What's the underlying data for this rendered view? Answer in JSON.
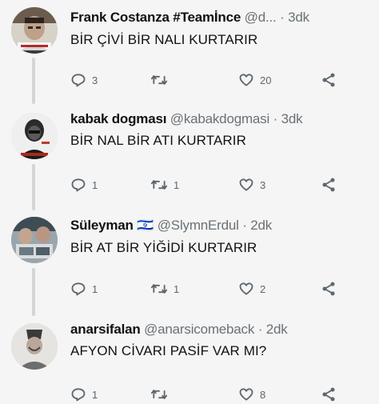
{
  "tweets": [
    {
      "name": "Frank Costanza #Teamİnce",
      "handle": "@d...",
      "time": "3dk",
      "text": "BİR ÇİVİ BİR NALI KURTARIR",
      "replies": "3",
      "retweets": "",
      "likes": "20",
      "avatar": "man-portrait-avatar"
    },
    {
      "name": "kabak dogması",
      "handle": "@kabakdogmasi",
      "time": "3dk",
      "text": "BİR NAL BİR ATI KURTARIR",
      "replies": "1",
      "retweets": "1",
      "likes": "3",
      "avatar": "bald-man-avatar"
    },
    {
      "name": "Süleyman",
      "flag": "🇮🇱",
      "handle": "@SlymnErdul",
      "time": "2dk",
      "text": "BİR AT BİR YİĞİDİ KURTARIR",
      "replies": "1",
      "retweets": "1",
      "likes": "2",
      "avatar": "tv-collage-avatar"
    },
    {
      "name": "anarsifalan",
      "handle": "@anarsicomeback",
      "time": "2dk",
      "text": "AFYON CİVARI PASİF VAR MI?",
      "replies": "1",
      "retweets": "",
      "likes": "8",
      "avatar": "fez-man-avatar"
    }
  ],
  "icons": [
    "reply-icon",
    "retweet-icon",
    "like-icon",
    "share-icon"
  ],
  "colors": {
    "background": "#f4f5f4",
    "muted": "#6b7177",
    "thread": "#d3d5d7"
  }
}
